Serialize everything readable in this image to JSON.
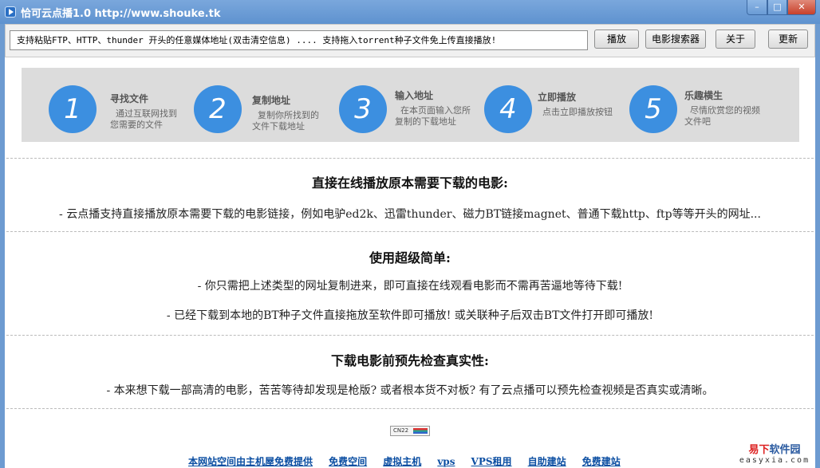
{
  "window": {
    "title": "恰可云点播1.0    http://www.shouke.tk",
    "controls": {
      "minimize": "–",
      "maximize": "□",
      "close": "✕"
    }
  },
  "toolbar": {
    "url_value": "支持粘贴FTP、HTTP、thunder 开头的任意媒体地址(双击清空信息) .... 支持拖入torrent种子文件免上传直接播放!",
    "play_label": "播放",
    "movie_search_label": "电影搜索器",
    "about_label": "关于",
    "update_label": "更新"
  },
  "steps": [
    {
      "number": "1",
      "title": "寻找文件",
      "desc": "  通过互联网找到\n您需要的文件"
    },
    {
      "number": "2",
      "title": "复制地址",
      "desc": "  复制你所找到的\n文件下载地址"
    },
    {
      "number": "3",
      "title": "输入地址",
      "desc": "  在本页面输入您所\n复制的下载地址"
    },
    {
      "number": "4",
      "title": "立即播放",
      "desc": "点击立即播放按钮"
    },
    {
      "number": "5",
      "title": "乐趣横生",
      "desc": "  尽情欣赏您的视频\n文件吧"
    }
  ],
  "sections": [
    {
      "heading": "直接在线播放原本需要下载的电影:",
      "lines": [
        "- 云点播支持直接播放原本需要下载的电影链接，例如电驴ed2k、迅雷thunder、磁力BT链接magnet、普通下载http、ftp等等开头的网址..."
      ]
    },
    {
      "heading": "使用超级简单:",
      "lines": [
        "- 你只需把上述类型的网址复制进来，即可直接在线观看电影而不需再苦逼地等待下载!",
        "- 已经下载到本地的BT种子文件直接拖放至软件即可播放! 或关联种子后双击BT文件打开即可播放!"
      ]
    },
    {
      "heading": "下载电影前预先检查真实性:",
      "lines": [
        "- 本来想下载一部高清的电影，苦苦等待却发现是枪版? 或者根本货不对板? 有了云点播可以预先检查视频是否真实或清晰。"
      ]
    }
  ],
  "badge": {
    "text": "CN22"
  },
  "footer_links": [
    "本网站空间由主机屋免费提供",
    "免费空间",
    "虚拟主机",
    "vps",
    "VPS租用",
    "自助建站",
    "免费建站"
  ],
  "watermark": {
    "cn_part1": "易下",
    "cn_part2": "软件园",
    "en": "easyxia.com"
  },
  "colors": {
    "accent": "#3c8fe0",
    "titlebar": "#6d9bd1",
    "link": "#0b4ea2"
  }
}
